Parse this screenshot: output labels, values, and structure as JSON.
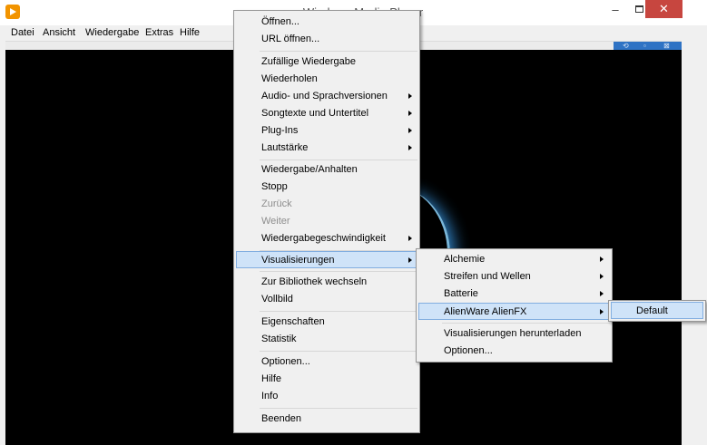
{
  "window": {
    "title": "Windows Media Player"
  },
  "menubar": [
    "Datei",
    "Ansicht",
    "Wiedergabe",
    "Extras",
    "Hilfe"
  ],
  "context_menu": {
    "items": [
      {
        "label": "Öffnen..."
      },
      {
        "label": "URL öffnen..."
      },
      {
        "label": "Zufällige Wiedergabe"
      },
      {
        "label": "Wiederholen"
      },
      {
        "label": "Audio- und Sprachversionen",
        "submenu": true
      },
      {
        "label": "Songtexte und Untertitel",
        "submenu": true
      },
      {
        "label": "Plug-Ins",
        "submenu": true
      },
      {
        "label": "Lautstärke",
        "submenu": true
      },
      {
        "label": "Wiedergabe/Anhalten"
      },
      {
        "label": "Stopp"
      },
      {
        "label": "Zurück",
        "disabled": true
      },
      {
        "label": "Weiter",
        "disabled": true
      },
      {
        "label": "Wiedergabegeschwindigkeit",
        "submenu": true
      },
      {
        "label": "Visualisierungen",
        "submenu": true,
        "highlighted": true
      },
      {
        "label": "Zur Bibliothek wechseln"
      },
      {
        "label": "Vollbild"
      },
      {
        "label": "Eigenschaften"
      },
      {
        "label": "Statistik"
      },
      {
        "label": "Optionen..."
      },
      {
        "label": "Hilfe"
      },
      {
        "label": "Info"
      },
      {
        "label": "Beenden"
      }
    ]
  },
  "visualizations_menu": {
    "items": [
      {
        "label": "Alchemie",
        "submenu": true
      },
      {
        "label": "Streifen und Wellen",
        "submenu": true
      },
      {
        "label": "Batterie",
        "submenu": true
      },
      {
        "label": "AlienWare AlienFX",
        "submenu": true,
        "highlighted": true
      },
      {
        "label": "Visualisierungen herunterladen"
      },
      {
        "label": "Optionen..."
      }
    ]
  },
  "alienfx_menu": {
    "items": [
      {
        "label": "Default",
        "highlighted": true
      }
    ]
  },
  "colors": {
    "close_button": "#c7463f",
    "highlight_bg": "#cfe3f8",
    "highlight_border": "#82aee0",
    "video_bg": "#000000"
  }
}
